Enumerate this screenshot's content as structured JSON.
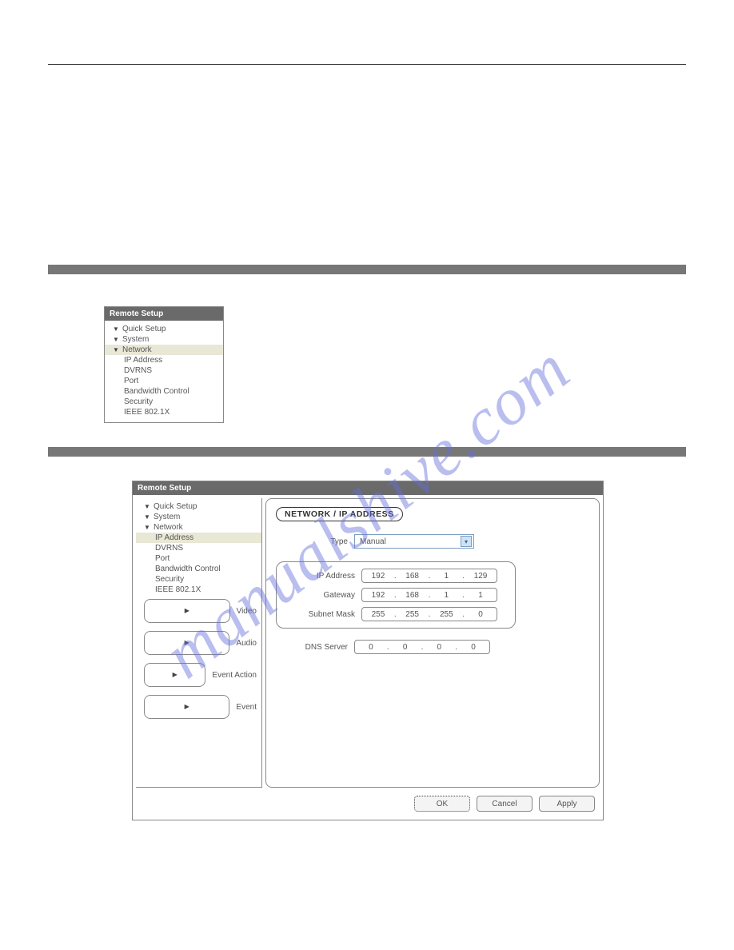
{
  "watermark": "manualshive.com",
  "sectionbar1": "",
  "sectionbar2": "",
  "smallPanel": {
    "title": "Remote Setup",
    "items": [
      {
        "label": "Quick Setup",
        "icon": "down",
        "indent": 0
      },
      {
        "label": "System",
        "icon": "down",
        "indent": 0
      },
      {
        "label": "Network",
        "icon": "down",
        "indent": 0,
        "selected": true
      },
      {
        "label": "IP Address",
        "icon": "",
        "indent": 1
      },
      {
        "label": "DVRNS",
        "icon": "",
        "indent": 1
      },
      {
        "label": "Port",
        "icon": "",
        "indent": 1
      },
      {
        "label": "Bandwidth Control",
        "icon": "",
        "indent": 1
      },
      {
        "label": "Security",
        "icon": "",
        "indent": 1
      },
      {
        "label": "IEEE 802.1X",
        "icon": "",
        "indent": 1
      }
    ]
  },
  "dialog": {
    "title": "Remote Setup",
    "tree": [
      {
        "label": "Quick Setup",
        "icon": "down",
        "indent": 0
      },
      {
        "label": "System",
        "icon": "down",
        "indent": 0
      },
      {
        "label": "Network",
        "icon": "down",
        "indent": 0
      },
      {
        "label": "IP Address",
        "icon": "",
        "indent": 1,
        "selected": true
      },
      {
        "label": "DVRNS",
        "icon": "",
        "indent": 1
      },
      {
        "label": "Port",
        "icon": "",
        "indent": 1
      },
      {
        "label": "Bandwidth Control",
        "icon": "",
        "indent": 1
      },
      {
        "label": "Security",
        "icon": "",
        "indent": 1
      },
      {
        "label": "IEEE 802.1X",
        "icon": "",
        "indent": 1
      },
      {
        "label": "Video",
        "icon": "right",
        "indent": 0
      },
      {
        "label": "Audio",
        "icon": "right",
        "indent": 0
      },
      {
        "label": "Event Action",
        "icon": "right",
        "indent": 0
      },
      {
        "label": "Event",
        "icon": "right",
        "indent": 0
      }
    ],
    "sectionTitle": "NETWORK / IP ADDRESS",
    "fields": {
      "typeLabel": "Type",
      "typeValue": "Manual",
      "ipLabel": "IP Address",
      "ip": [
        "192",
        "168",
        "1",
        "129"
      ],
      "gatewayLabel": "Gateway",
      "gateway": [
        "192",
        "168",
        "1",
        "1"
      ],
      "subnetLabel": "Subnet Mask",
      "subnet": [
        "255",
        "255",
        "255",
        "0"
      ],
      "dnsLabel": "DNS Server",
      "dns": [
        "0",
        "0",
        "0",
        "0"
      ]
    },
    "buttons": {
      "ok": "OK",
      "cancel": "Cancel",
      "apply": "Apply"
    }
  }
}
